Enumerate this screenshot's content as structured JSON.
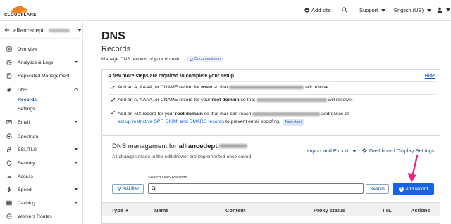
{
  "topbar": {
    "logo_text": "CLOUDFLARE",
    "add_site": "Add site",
    "support": "Support",
    "language": "English (US)"
  },
  "sidebar": {
    "account": "alliancedept.",
    "items": [
      {
        "label": "Overview",
        "icon": "overview-icon"
      },
      {
        "label": "Analytics & Logs",
        "icon": "analytics-icon",
        "expand": true
      },
      {
        "label": "Replicated Management",
        "icon": "replicated-icon"
      },
      {
        "label": "DNS",
        "icon": "dns-icon",
        "open": true
      },
      {
        "label": "Email",
        "icon": "email-icon",
        "expand": true
      },
      {
        "label": "Spectrum",
        "icon": "spectrum-icon"
      },
      {
        "label": "SSL/TLS",
        "icon": "lock-icon",
        "expand": true
      },
      {
        "label": "Security",
        "icon": "shield-icon",
        "expand": true
      },
      {
        "label": "Access",
        "icon": "access-icon"
      },
      {
        "label": "Speed",
        "icon": "speed-icon",
        "expand": true
      },
      {
        "label": "Caching",
        "icon": "caching-icon",
        "expand": true
      },
      {
        "label": "Workers Routes",
        "icon": "workers-icon"
      }
    ],
    "dns_sub": [
      "Records",
      "Settings"
    ]
  },
  "page": {
    "title": "DNS",
    "subtitle": "Records",
    "description": "Manage DNS records of your domain.",
    "doc_badge": "Documentation"
  },
  "setup": {
    "title": "A few more steps are required to complete your setup.",
    "hide": "Hide",
    "step1": {
      "a": "Add an A, AAAA, or CNAME record for ",
      "b": "www",
      "c": " so that ",
      "d": " will resolve."
    },
    "step2": {
      "a": "Add an A, AAAA, or CNAME record for your ",
      "b": "root domain",
      "c": " so that ",
      "d": " will resolve."
    },
    "step3": {
      "a": "Add an MX record for your ",
      "b": "root domain",
      "c": " so that mail can reach ",
      "d": " addresses or",
      "link": "set up restrictive SPF, DKIM, and DMARC records",
      "e": " to prevent email spoofing.",
      "badge": "New Alert"
    }
  },
  "dns_mgmt": {
    "title_prefix": "DNS management for ",
    "title_domain": "alliancedept.",
    "note": "All changes made in the edit drawer are implemented once saved.",
    "import_export": "Import and Export",
    "dashboard_settings": "Dashboard Display Settings",
    "search_label": "Search DNS Records",
    "search_placeholder": "",
    "add_filter": "Add filter",
    "search_button": "Search",
    "add_record": "Add record",
    "columns": [
      "Type",
      "Name",
      "Content",
      "Proxy status",
      "TTL",
      "Actions"
    ]
  },
  "colors": {
    "accent": "#1565e0",
    "annotation_arrow": "#e6267a",
    "cloud_orange": "#f48120"
  }
}
